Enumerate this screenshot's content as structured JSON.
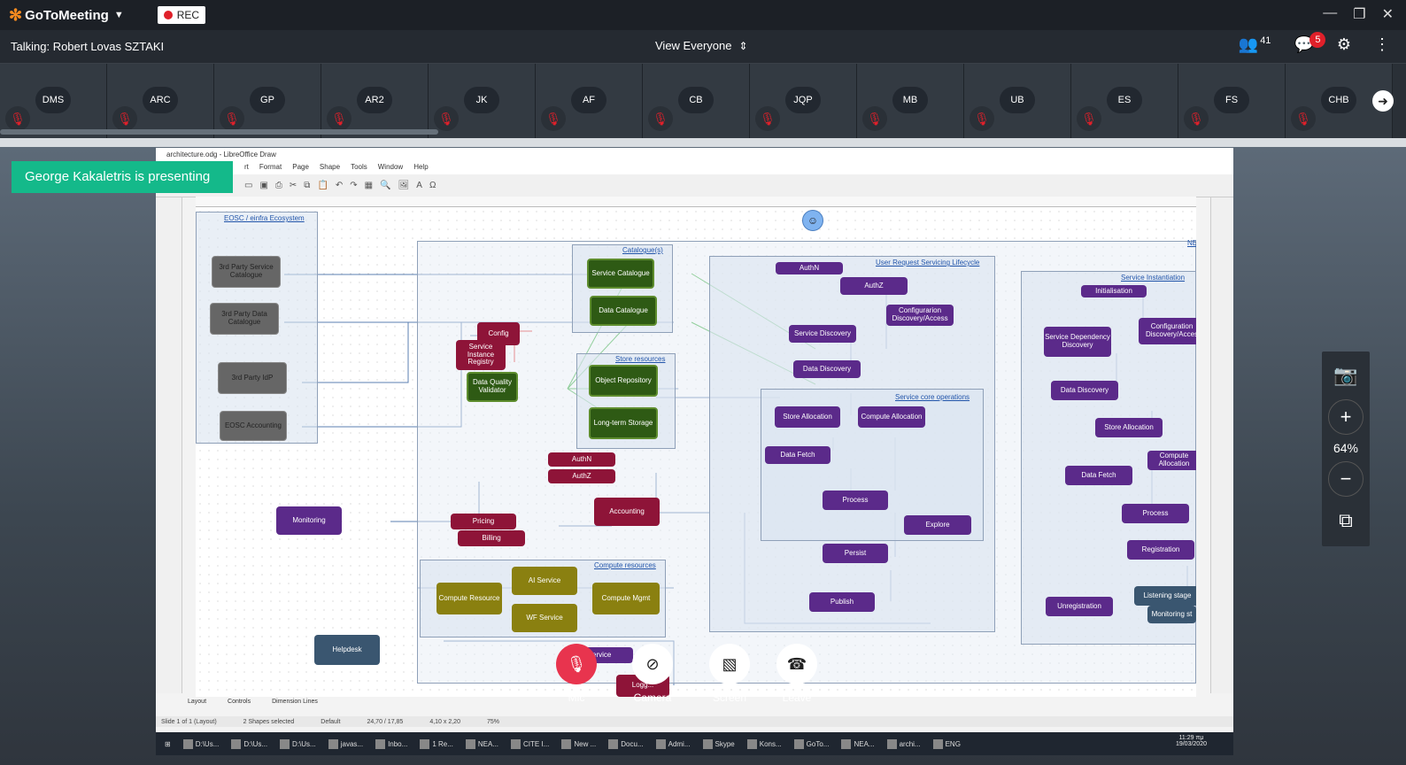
{
  "app": {
    "brand": "GoToMeeting",
    "rec_label": "REC"
  },
  "infobar": {
    "talking": "Talking: Robert Lovas SZTAKI",
    "view": "View Everyone",
    "attendees_count": "41",
    "chat_badge": "5"
  },
  "participants": [
    "DMS",
    "ARC",
    "GP",
    "AR2",
    "JK",
    "AF",
    "CB",
    "JQP",
    "MB",
    "UB",
    "ES",
    "FS",
    "CHB"
  ],
  "presenting_banner": "George Kakaletris is presenting",
  "zoom": {
    "value": "64%"
  },
  "controls": {
    "mic": "Mic",
    "camera": "Camera",
    "screen": "Screen",
    "leave": "Leave"
  },
  "libreoffice": {
    "title": "architecture.odg - LibreOffice Draw",
    "menu": [
      "rt",
      "Format",
      "Page",
      "Shape",
      "Tools",
      "Window",
      "Help"
    ],
    "tabs": [
      "Layout",
      "Controls",
      "Dimension Lines"
    ],
    "status": [
      "Slide 1 of 1 (Layout)",
      "2 Shapes selected",
      "Default",
      "24,70 / 17,85",
      "4,10 x 2,20",
      "75%"
    ],
    "clock": [
      "11:29 πμ",
      "19/03/2020"
    ],
    "taskbar": [
      "D:\\Us...",
      "D:\\Us...",
      "D:\\Us...",
      "javas...",
      "Inbo...",
      "1 Re...",
      "NEA...",
      "CITE I...",
      "New ...",
      "Docu...",
      "Admi...",
      "Skype",
      "Kons...",
      "GoTo...",
      "NEA...",
      "archi...",
      "ENG"
    ],
    "regions": {
      "eosc": "EOSC / einfra Ecosystem",
      "catalogues": "Catalogue(s)",
      "store": "Store resources",
      "compute": "Compute resources",
      "lifecycle": "User Request Servicing Lifecycle",
      "core": "Service core operations",
      "instantiation": "Service Instantiation",
      "ne": "NE"
    },
    "boxes": {
      "b1": "3rd Party Service Catalogue",
      "b2": "3rd Party Data Catalogue",
      "b3": "3rd Party IdP",
      "b4": "EOSC Accounting",
      "b5": "Monitoring",
      "b6": "Helpdesk",
      "b7": "Service Catalogue",
      "b8": "Data Catalogue",
      "b9": "Config",
      "b10": "Service Instance Registry",
      "b11": "Data Quality Validator",
      "b12": "Object Repository",
      "b13": "Long-term Storage",
      "b14": "AuthN",
      "b15": "AuthZ",
      "b16": "Accounting",
      "b17": "Pricing",
      "b18": "Billing",
      "b19": "Compute Resource",
      "b20": "AI Service",
      "b21": "WF Service",
      "b22": "Compute Mgmt",
      "b23": "Service",
      "b24": "Logg...",
      "b25": "AuthN",
      "b26": "AuthZ",
      "b27": "Configurarion Discovery/Access",
      "b28": "Service Discovery",
      "b29": "Data Discovery",
      "b30": "Store Allocation",
      "b31": "Compute Allocation",
      "b32": "Data Fetch",
      "b33": "Process",
      "b34": "Explore",
      "b35": "Persist",
      "b36": "Publish",
      "b37": "Initialisation",
      "b38": "Service Dependency Discovery",
      "b39": "Configuration Discovery/Acces",
      "b40": "Data Discovery",
      "b41": "Store Allocation",
      "b42": "Compute Allocation",
      "b43": "Data Fetch",
      "b44": "Process",
      "b45": "Registration",
      "b46": "Unregistration",
      "b47": "Listening stage",
      "b48": "Monitoring st"
    }
  },
  "colors": {
    "brand_accent": "#f68b1f",
    "rec_red": "#e0202a",
    "presenting_green": "#14b98a",
    "mic_red": "#e8344e"
  }
}
